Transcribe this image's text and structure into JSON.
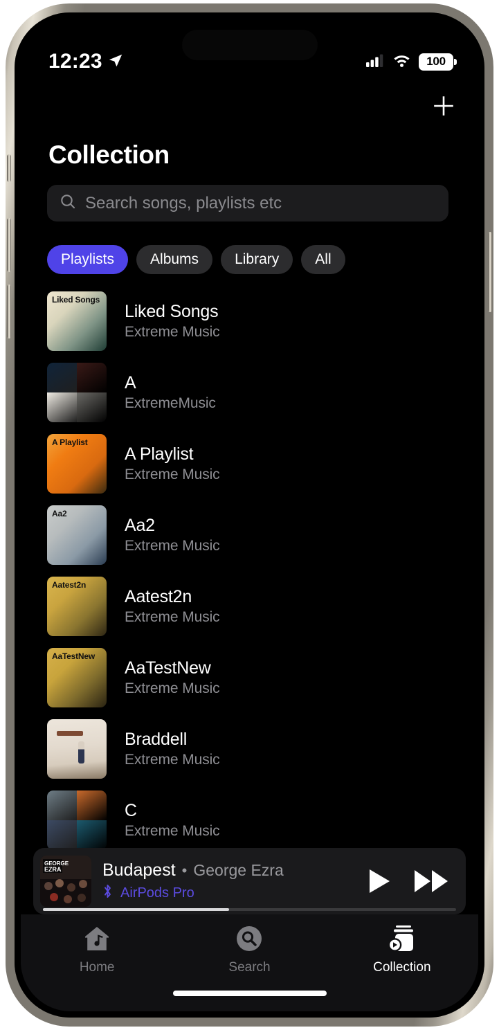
{
  "status_bar": {
    "time": "12:23",
    "location_icon": "location-arrow-icon",
    "cellular_icon": "cellular-bars-icon",
    "wifi_icon": "wifi-icon",
    "battery_level": "100",
    "battery_icon": "battery-icon"
  },
  "header": {
    "title": "Collection",
    "add_icon": "plus-icon"
  },
  "search": {
    "placeholder": "Search songs, playlists etc",
    "value": "",
    "icon": "search-icon"
  },
  "filters": {
    "active": "Playlists",
    "chips": [
      {
        "label": "Playlists",
        "active": true
      },
      {
        "label": "Albums",
        "active": false
      },
      {
        "label": "Library",
        "active": false
      },
      {
        "label": "All",
        "active": false
      }
    ]
  },
  "accent_colors": {
    "chip_active": "#4f43e8",
    "device_link": "#5b4be0",
    "list_subtitle": "#8e8e93",
    "search_bg": "#1c1c1e",
    "chip_bg": "#2c2c2e",
    "player_bg": "#1a1a1c",
    "tabbar_bg": "#111113"
  },
  "playlists": [
    {
      "title": "Liked Songs",
      "subtitle": "Extreme Music",
      "cover_label": "Liked Songs",
      "cover_type": "gradient",
      "cover_colors": [
        "#efe6cf",
        "#d9d5bc",
        "#7f9486",
        "#1e3c34"
      ]
    },
    {
      "title": "A",
      "subtitle": "ExtremeMusic",
      "cover_label": "",
      "cover_type": "collage",
      "cover_colors": [
        "#10243a",
        "#3a1a17",
        "#f0ece4",
        "#6b6a66"
      ]
    },
    {
      "title": "A Playlist",
      "subtitle": "Extreme Music",
      "cover_label": "A Playlist",
      "cover_type": "gradient",
      "cover_colors": [
        "#f2a43c",
        "#f07c12",
        "#d96a10",
        "#3a2a10"
      ]
    },
    {
      "title": "Aa2",
      "subtitle": "Extreme Music",
      "cover_label": "Aa2",
      "cover_type": "gradient",
      "cover_colors": [
        "#c9cccb",
        "#b7bcbd",
        "#8b9aa6",
        "#2b3d52"
      ]
    },
    {
      "title": "Aatest2n",
      "subtitle": "Extreme Music",
      "cover_label": "Aatest2n",
      "cover_type": "gradient",
      "cover_colors": [
        "#d9b54e",
        "#c9a43f",
        "#8a7530",
        "#2e2614"
      ]
    },
    {
      "title": "AaTestNew",
      "subtitle": "Extreme Music",
      "cover_label": "AaTestNew",
      "cover_type": "gradient",
      "cover_colors": [
        "#d6b04a",
        "#c8a43c",
        "#7d6a2c",
        "#2a2312"
      ]
    },
    {
      "title": "Braddell",
      "subtitle": "Extreme Music",
      "cover_label": "",
      "cover_type": "photo",
      "cover_colors": [
        "#ede6dc",
        "#e3dace",
        "#d7ccbd",
        "#8a7a66"
      ]
    },
    {
      "title": "C",
      "subtitle": "Extreme Music",
      "cover_label": "",
      "cover_type": "collage",
      "cover_colors": [
        "#6e7d86",
        "#c96a2c",
        "#3c4a63",
        "#1c5a6e"
      ]
    }
  ],
  "now_playing": {
    "title": "Budapest",
    "separator": "•",
    "artist": "George Ezra",
    "device": "AirPods Pro",
    "bluetooth_icon": "bluetooth-icon",
    "play_icon": "play-icon",
    "next_icon": "fast-forward-icon",
    "progress_percent": 45
  },
  "tab_bar": {
    "active": "Collection",
    "tabs": [
      {
        "label": "Home",
        "icon": "home-music-icon",
        "active": false
      },
      {
        "label": "Search",
        "icon": "search-circle-icon",
        "active": false
      },
      {
        "label": "Collection",
        "icon": "collection-stack-icon",
        "active": true
      }
    ]
  }
}
